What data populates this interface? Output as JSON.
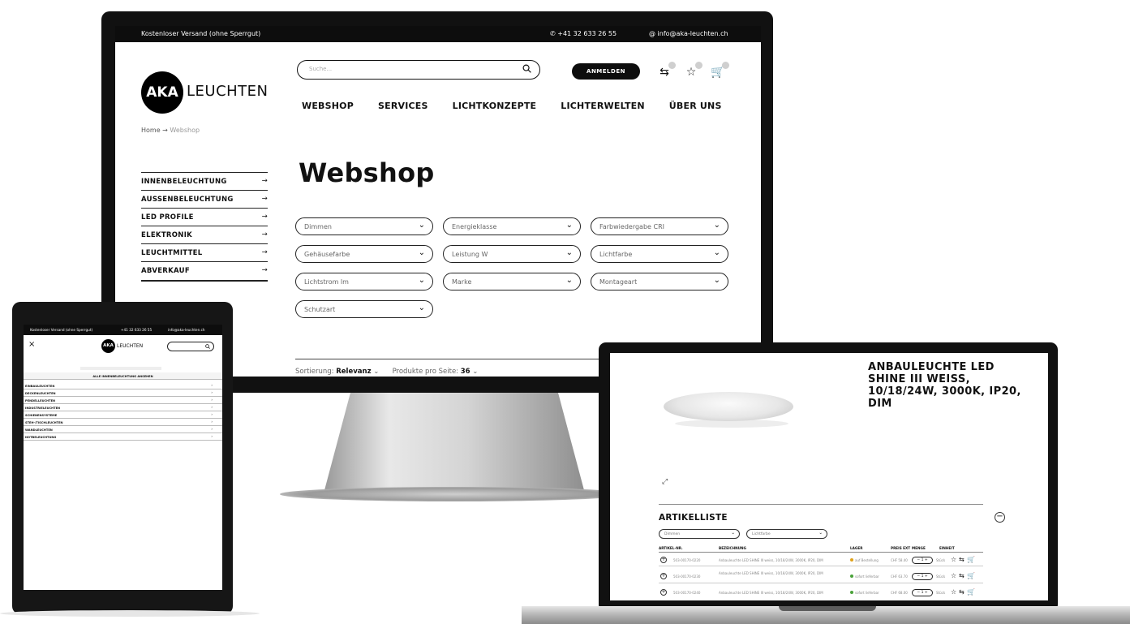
{
  "monitor": {
    "topbar": {
      "shipping": "Kostenloser Versand (ohne Sperrgut)",
      "phone": "+41 32 633 26 55",
      "email": "info@aka-leuchten.ch"
    },
    "logo": {
      "mark": "AKA",
      "word": "LEUCHTEN"
    },
    "breadcrumb": {
      "home": "Home",
      "sep": "→",
      "current": "Webshop"
    },
    "search": {
      "placeholder": "Suche..."
    },
    "login": "ANMELDEN",
    "nav": [
      "WEBSHOP",
      "SERVICES",
      "LICHTKONZEPTE",
      "LICHTERWELTEN",
      "ÜBER UNS"
    ],
    "sidebar": [
      {
        "label": "INNENBELEUCHTUNG",
        "arrow": "→"
      },
      {
        "label": "AUSSENBELEUCHTUNG",
        "arrow": "→"
      },
      {
        "label": "LED PROFILE",
        "arrow": "→"
      },
      {
        "label": "ELEKTRONIK",
        "arrow": "→"
      },
      {
        "label": "LEUCHTMITTEL",
        "arrow": "→"
      },
      {
        "label": "ABVERKAUF",
        "arrow": "→"
      }
    ],
    "title": "Webshop",
    "filters": [
      "Dimmen",
      "Energieklasse",
      "Farbwiedergabe CRI",
      "Gehäusefarbe",
      "Leistung W",
      "Lichtfarbe",
      "Lichtstrom lm",
      "Marke",
      "Montageart",
      "Schutzart"
    ],
    "sort": {
      "label": "Sortierung:",
      "value": "Relevanz",
      "per_page_label": "Produkte pro Seite:",
      "per_page_value": "36"
    }
  },
  "tablet": {
    "topbar": {
      "shipping": "Kostenloser Versand (ohne Sperrgut)",
      "phone": "+41 32 633 26 55",
      "email": "info@aka-leuchten.ch"
    },
    "logo": {
      "mark": "AKA",
      "word": "LEUCHTEN"
    },
    "close": "×",
    "all_link": "ALLE INNENBELEUCHTUNG ANSEHEN",
    "categories": [
      "EINBAULEUCHTEN",
      "DECKENLEUCHTEN",
      "PENDELLEUCHTEN",
      "INDUSTRIELEUCHTEN",
      "SCHIENENSYSTEME",
      "STEH-/TISCHLEUCHTEN",
      "WANDLEUCHTEN",
      "NOTBELEUCHTUNG"
    ]
  },
  "laptop": {
    "product_title": "ANBAULEUCHTE LED SHINE III WEISS, 10/18/24W, 3000K, IP20, DIM",
    "article_list_title": "ARTIKELLISTE",
    "filters": [
      "Dimmen",
      "Lichtfarbe"
    ],
    "columns": [
      "ARTIKEL-NR.",
      "BEZEICHNUNG",
      "LAGER",
      "PREIS EXT",
      "MENGE",
      "EINHEIT"
    ],
    "rows": [
      {
        "nr": "503-00170-0220",
        "desc": "Anbauleuchte LED SHINE III weiss, 10/18/24W, 3000K, IP20, DIM",
        "stock": "auf Bestellung",
        "price": "CHF 58.40",
        "qty": "1",
        "unit": "Stück"
      },
      {
        "nr": "503-00170-0230",
        "desc": "Anbauleuchte LED SHINE III weiss, 10/18/24W, 3000K, IP20, DIM",
        "stock": "sofort lieferbar",
        "price": "CHF 63.70",
        "qty": "1",
        "unit": "Stück"
      },
      {
        "nr": "503-00170-0240",
        "desc": "Anbauleuchte LED SHINE III weiss, 10/18/24W, 3000K, IP20, DIM",
        "stock": "sofort lieferbar",
        "price": "CHF 68.00",
        "qty": "1",
        "unit": "Stück"
      }
    ]
  }
}
